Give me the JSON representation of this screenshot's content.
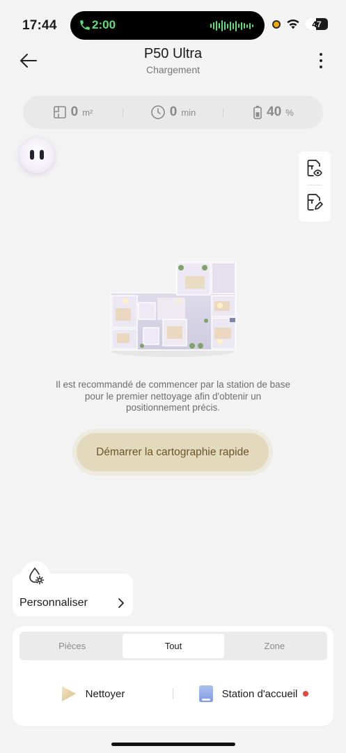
{
  "status_bar": {
    "time": "17:44",
    "call_time": "2:00",
    "battery": "47",
    "battery_level": 0.47,
    "accent_green": "#5fe07a"
  },
  "header": {
    "title": "P50 Ultra",
    "subtitle": "Chargement",
    "back_icon": "arrow-left-icon",
    "more_icon": "more-vertical-icon"
  },
  "stats": {
    "area": {
      "value": "0",
      "unit": "m²",
      "icon": "area-icon"
    },
    "time": {
      "value": "0",
      "unit": "min",
      "icon": "clock-icon"
    },
    "battery": {
      "value": "40",
      "unit": "%",
      "icon": "battery-icon"
    }
  },
  "tools": [
    {
      "icon": "map-view-icon"
    },
    {
      "icon": "map-edit-icon"
    }
  ],
  "main": {
    "hint_lines": [
      "Il est recommandé de commencer par la station de base",
      "pour le premier nettoyage afin d'obtenir un",
      "positionnement précis."
    ],
    "start_button": "Démarrer la cartographie rapide"
  },
  "personalize": {
    "label": "Personnaliser",
    "icon": "water-drop-settings-icon"
  },
  "tabs": [
    {
      "label": "Pièces",
      "active": false
    },
    {
      "label": "Tout",
      "active": true
    },
    {
      "label": "Zone",
      "active": false
    }
  ],
  "actions": {
    "clean": {
      "label": "Nettoyer",
      "icon": "play-icon"
    },
    "dock": {
      "label": "Station d'accueil",
      "icon": "dock-station-icon",
      "status_color": "#e0483c"
    }
  },
  "colors": {
    "background": "#f3f3f3",
    "button_bg": "#e3d9bd",
    "button_text": "#6b5628"
  }
}
